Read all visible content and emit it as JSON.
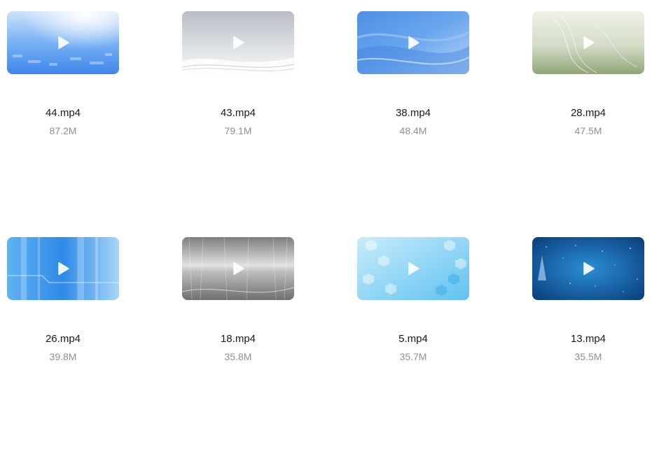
{
  "files": [
    {
      "name": "44.mp4",
      "size": "87.2M",
      "thumbnail": "blue-light-flare",
      "colors": [
        "#7fb6f5",
        "#3d86ea"
      ]
    },
    {
      "name": "43.mp4",
      "size": "79.1M",
      "thumbnail": "silver-waves",
      "colors": [
        "#c3c7cd",
        "#f4f5f7"
      ]
    },
    {
      "name": "38.mp4",
      "size": "48.4M",
      "thumbnail": "blue-waves",
      "colors": [
        "#4e8fe6",
        "#9cc6f4"
      ]
    },
    {
      "name": "28.mp4",
      "size": "47.5M",
      "thumbnail": "green-gradient",
      "colors": [
        "#dde5d0",
        "#93a87a"
      ]
    },
    {
      "name": "26.mp4",
      "size": "39.8M",
      "thumbnail": "blue-tech-lines",
      "colors": [
        "#2f8ae8",
        "#a6d6f8"
      ]
    },
    {
      "name": "18.mp4",
      "size": "35.8M",
      "thumbnail": "gray-metal",
      "colors": [
        "#8c8c8c",
        "#e8e8e8"
      ]
    },
    {
      "name": "5.mp4",
      "size": "35.7M",
      "thumbnail": "light-blue-hexagons",
      "colors": [
        "#a9ddf7",
        "#5fc2f1"
      ]
    },
    {
      "name": "13.mp4",
      "size": "35.5M",
      "thumbnail": "dark-blue-starfield",
      "colors": [
        "#0a3d7a",
        "#2a8fd6"
      ]
    }
  ],
  "icons": {
    "play": "play-icon"
  }
}
